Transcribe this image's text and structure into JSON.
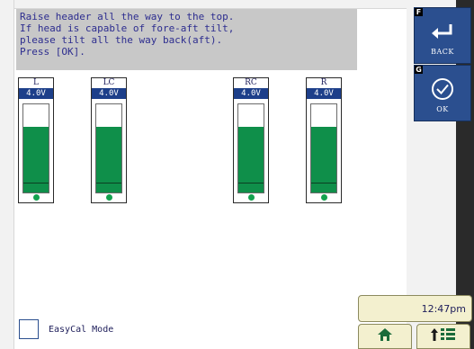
{
  "instructions": {
    "text": "Raise header all the way to the top.\nIf head is capable of fore-aft tilt,\nplease tilt all the way back(aft).\nPress [OK]."
  },
  "softkeys": {
    "back": {
      "letter": "F",
      "label": "BACK",
      "icon": "return-arrow-icon"
    },
    "ok": {
      "letter": "G",
      "label": "OK",
      "icon": "checkmark-circle-icon"
    }
  },
  "gauges": [
    {
      "name": "L",
      "voltage": "4.0V",
      "level": 0.75
    },
    {
      "name": "LC",
      "voltage": "4.0V",
      "level": 0.75
    },
    {
      "name": "RC",
      "voltage": "4.0V",
      "level": 0.75
    },
    {
      "name": "R",
      "voltage": "4.0V",
      "level": 0.75
    }
  ],
  "easycal": {
    "label": "EasyCal Mode",
    "checked": false
  },
  "clock": {
    "time": "12:47pm"
  },
  "nav": {
    "home_icon": "home-icon",
    "menu_icon": "up-arrow-menu-icon"
  },
  "colors": {
    "accent": "#2b4f8f",
    "gauge_fill": "#0f8f4a",
    "voltage_bar": "#1d3f8a",
    "instruction_bg": "#c8c8c8",
    "instruction_text": "#2d2d8f"
  }
}
